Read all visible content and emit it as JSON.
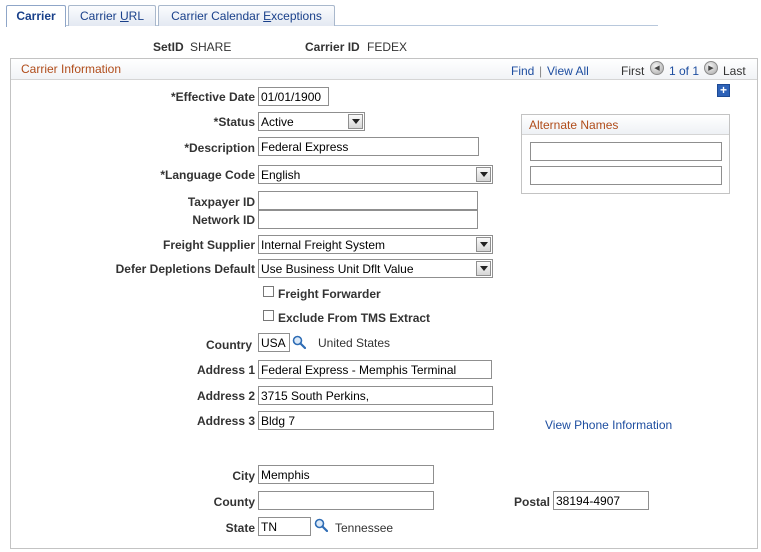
{
  "tabs": [
    {
      "label": "Carrier",
      "active": true
    },
    {
      "label_pre": "Carrier ",
      "label_ul": "U",
      "label_post": "RL"
    },
    {
      "label_pre": "Carrier Calendar ",
      "label_ul": "E",
      "label_post": "xceptions"
    }
  ],
  "key": {
    "setid_label": "SetID",
    "setid_value": "SHARE",
    "carrier_id_label": "Carrier ID",
    "carrier_id_value": "FEDEX"
  },
  "group": {
    "title": "Carrier Information",
    "find": "Find",
    "separator": "|",
    "view_all": "View All",
    "first": "First",
    "range": "1 of 1",
    "last": "Last",
    "add": "+"
  },
  "form": {
    "effective_date_label": "*Effective Date",
    "effective_date_value": "01/01/1900",
    "status_label": "*Status",
    "status_value": "Active",
    "description_label": "*Description",
    "description_value": "Federal Express",
    "language_label": "*Language Code",
    "language_value": "English",
    "taxpayer_label": "Taxpayer ID",
    "taxpayer_value": "",
    "network_label": "Network ID",
    "network_value": "",
    "freight_supplier_label": "Freight Supplier",
    "freight_supplier_value": "Internal Freight System",
    "defer_label": "Defer Depletions Default",
    "defer_value": "Use Business Unit Dflt Value",
    "freight_forwarder_label": "Freight Forwarder",
    "freight_forwarder_checked": false,
    "exclude_tms_label": "Exclude From TMS Extract",
    "exclude_tms_checked": false,
    "country_label": "Country",
    "country_value": "USA",
    "country_desc": "United States",
    "address1_label": "Address 1",
    "address1_value": "Federal Express - Memphis Terminal",
    "address2_label": "Address 2",
    "address2_value": "3715 South Perkins,",
    "address3_label": "Address 3",
    "address3_value": "Bldg 7",
    "phone_link": "View Phone Information",
    "city_label": "City",
    "city_value": "Memphis",
    "county_label": "County",
    "county_value": "",
    "postal_label": "Postal",
    "postal_value": "38194-4907",
    "state_label": "State",
    "state_value": "TN",
    "state_desc": "Tennessee"
  },
  "alternate_names": {
    "title": "Alternate Names",
    "name1": "",
    "name2": ""
  },
  "icons": {
    "lookup": "magnifier-icon",
    "prev": "arrow-left-icon",
    "next": "arrow-right-icon",
    "dropdown": "triangle-down-icon"
  },
  "colors": {
    "tab_text": "#19408a",
    "group_title": "#b04c1a",
    "link": "#1e4ea0"
  }
}
